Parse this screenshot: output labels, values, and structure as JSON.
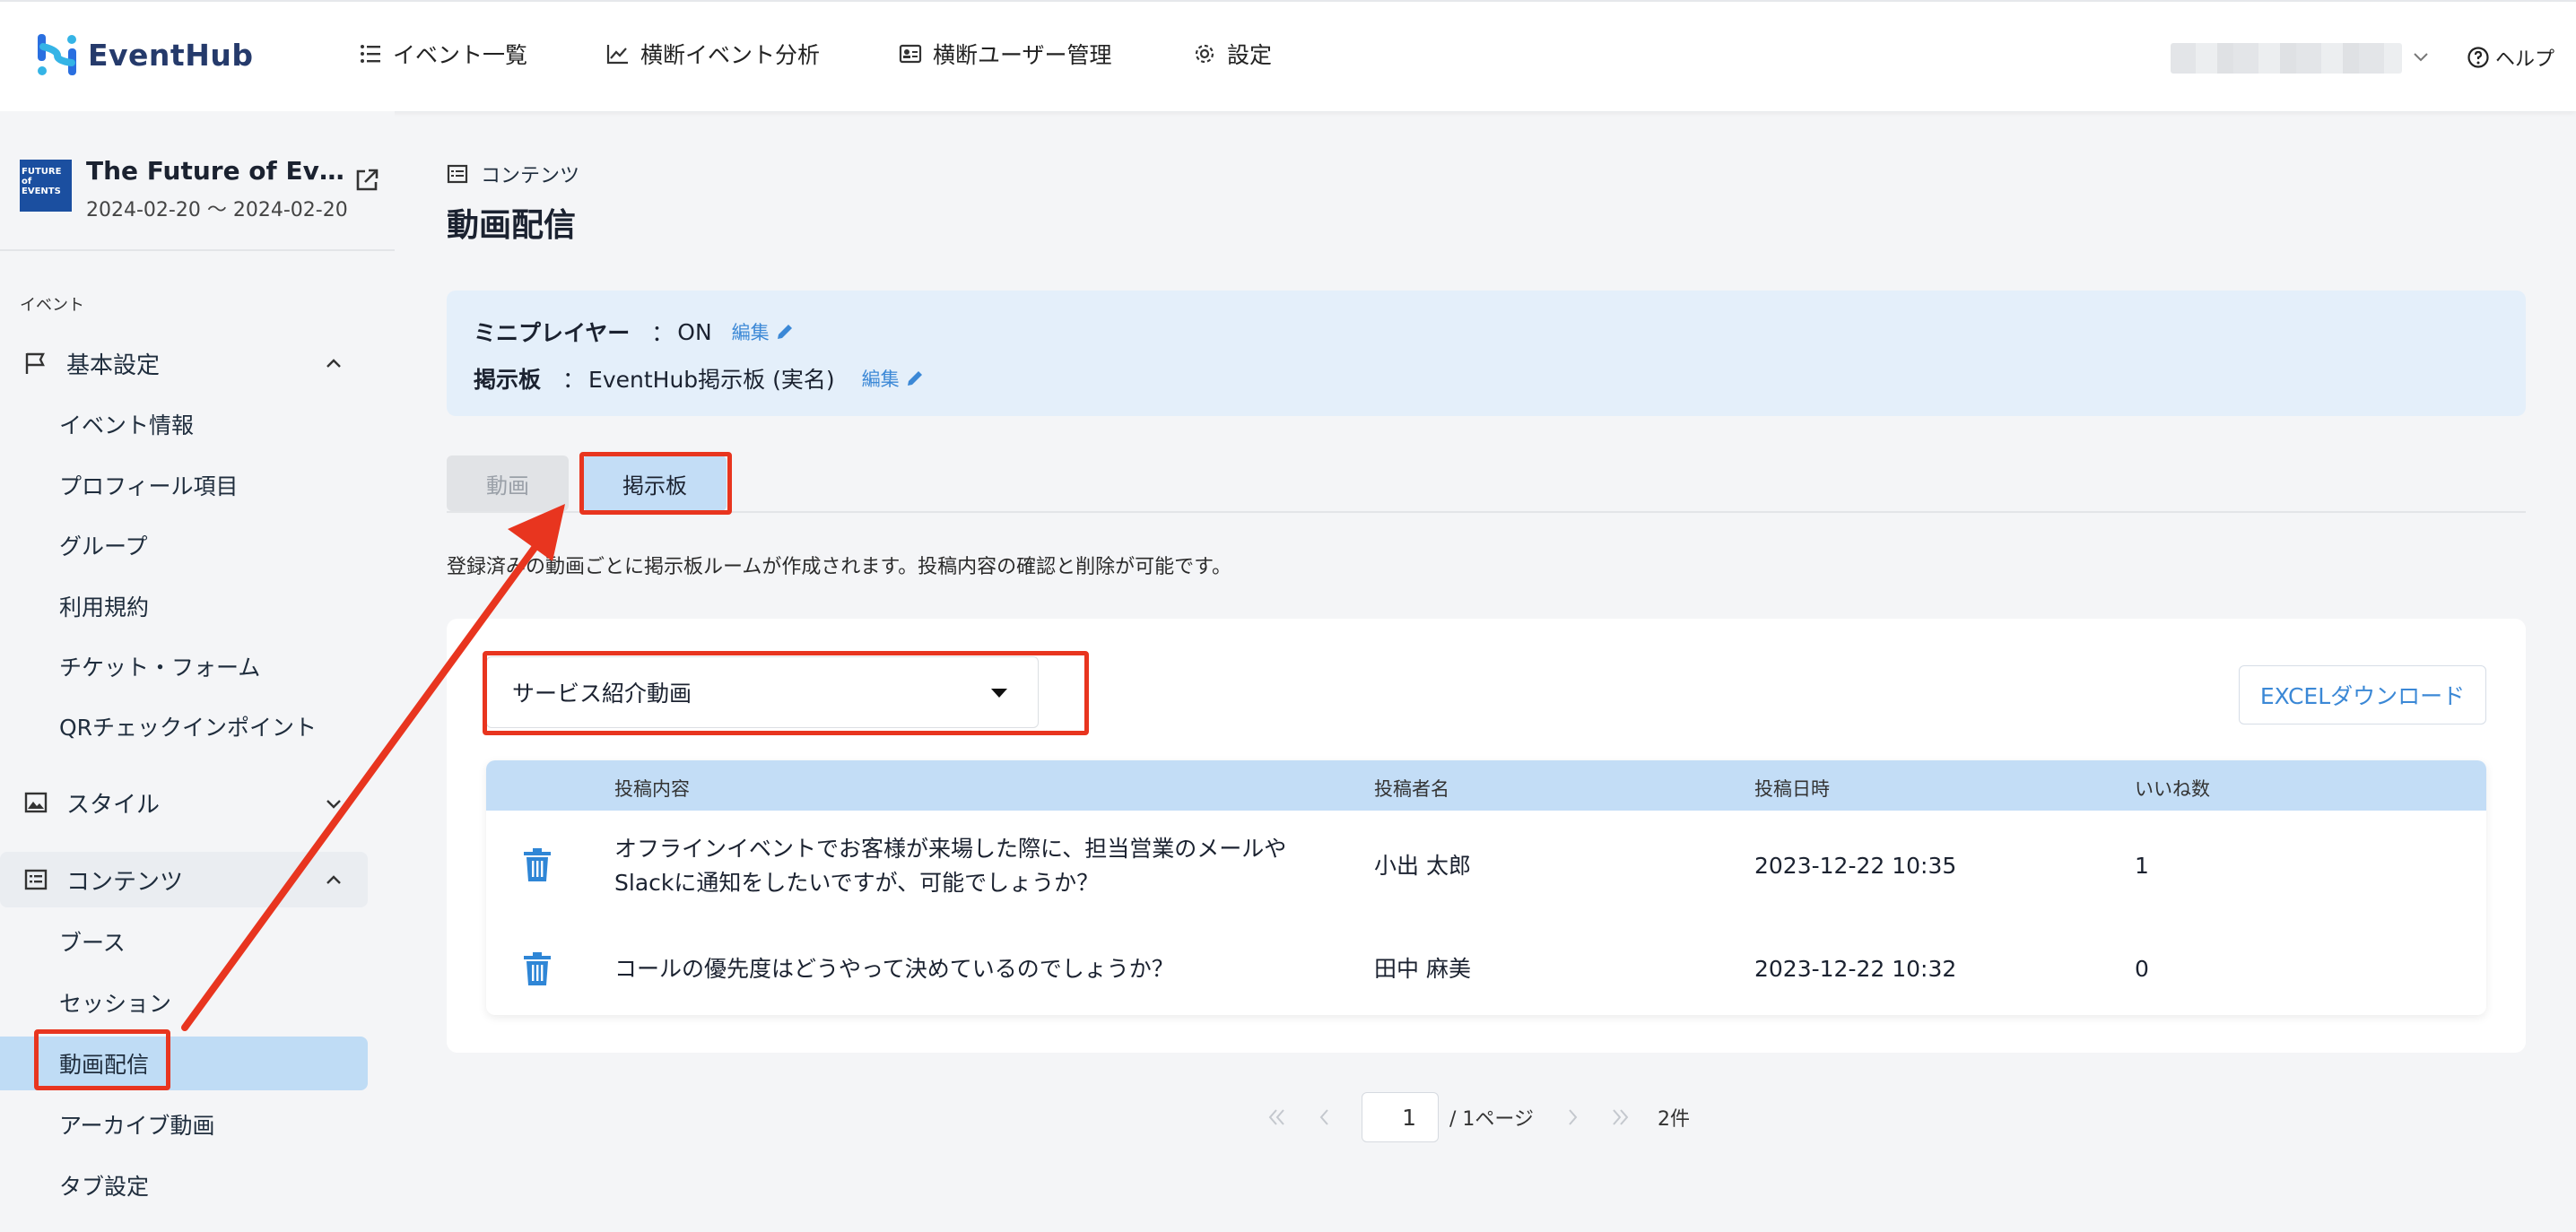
{
  "header": {
    "logo_text": "EventHub",
    "nav": [
      {
        "label": "イベント一覧",
        "icon": "list-icon"
      },
      {
        "label": "横断イベント分析",
        "icon": "chart-icon"
      },
      {
        "label": "横断ユーザー管理",
        "icon": "id-card-icon"
      },
      {
        "label": "設定",
        "icon": "gear-icon"
      }
    ],
    "help_label": "ヘルプ"
  },
  "sidebar": {
    "event": {
      "title": "The Future of Events",
      "date": "2024-02-20 〜 2024-02-20",
      "thumb_text": "FUTURE of EVENTS"
    },
    "section_label": "イベント",
    "groups": {
      "basic": {
        "label": "基本設定",
        "icon": "flag-icon"
      },
      "style": {
        "label": "スタイル",
        "icon": "image-icon"
      },
      "contents": {
        "label": "コンテンツ",
        "icon": "list-box-icon"
      }
    },
    "basic_items": [
      "イベント情報",
      "プロフィール項目",
      "グループ",
      "利用規約",
      "チケット・フォーム",
      "QRチェックインポイント"
    ],
    "content_items": [
      "ブース",
      "セッション",
      "動画配信",
      "アーカイブ動画",
      "タブ設定"
    ],
    "active_item": "動画配信"
  },
  "main": {
    "breadcrumb": "コンテンツ",
    "title": "動画配信",
    "info": {
      "miniplayer_label": "ミニプレイヤー",
      "miniplayer_value": "ON",
      "board_label": "掲示板",
      "board_value": "EventHub掲示板 (実名)",
      "separator": "：",
      "edit_label": "編集"
    },
    "tabs": [
      {
        "label": "動画",
        "state": "disabled"
      },
      {
        "label": "掲示板",
        "state": "active"
      }
    ],
    "description": "登録済みの動画ごとに掲示板ルームが作成されます。投稿内容の確認と削除が可能です。",
    "select_value": "サービス紹介動画",
    "excel_button": "EXCELダウンロード",
    "table": {
      "headers": [
        "投稿内容",
        "投稿者名",
        "投稿日時",
        "いいね数"
      ],
      "rows": [
        {
          "content_line1": "オフラインイベントでお客様が来場した際に、担当営業のメールや",
          "content_line2": "Slackに通知をしたいですが、可能でしょうか？",
          "author": "小出 太郎",
          "datetime": "2023-12-22 10:35",
          "likes": "1"
        },
        {
          "content_line1": "コールの優先度はどうやって決めているのでしょうか？",
          "content_line2": "",
          "author": "田中 麻美",
          "datetime": "2023-12-22 10:32",
          "likes": "0"
        }
      ]
    },
    "pagination": {
      "current_page": "1",
      "total_label": "/ 1ページ",
      "count": "2件"
    }
  },
  "colors": {
    "accent": "#3b88d6",
    "tab_active": "#c3ddf6",
    "annotation": "#e8351f"
  }
}
